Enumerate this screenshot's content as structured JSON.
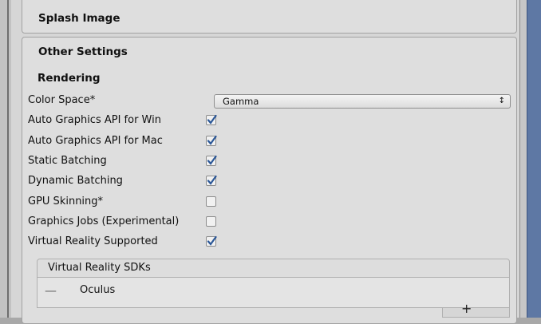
{
  "sections": {
    "splash_image": "Splash Image",
    "other_settings": "Other Settings"
  },
  "rendering": {
    "heading": "Rendering",
    "rows": [
      {
        "label": "Color Space*",
        "type": "dropdown",
        "value": "Gamma"
      },
      {
        "label": "Auto Graphics API for Win",
        "type": "checkbox",
        "checked": true
      },
      {
        "label": "Auto Graphics API for Mac",
        "type": "checkbox",
        "checked": true
      },
      {
        "label": "Static Batching",
        "type": "checkbox",
        "checked": true
      },
      {
        "label": "Dynamic Batching",
        "type": "checkbox",
        "checked": true
      },
      {
        "label": "GPU Skinning*",
        "type": "checkbox",
        "checked": false
      },
      {
        "label": "Graphics Jobs (Experimental)",
        "type": "checkbox",
        "checked": false
      },
      {
        "label": "Virtual Reality Supported",
        "type": "checkbox",
        "checked": true
      }
    ]
  },
  "vr_sdks": {
    "header": "Virtual Reality SDKs",
    "items": [
      "Oculus"
    ],
    "add_symbol": "+"
  },
  "icons": {
    "checkmark": "checkmark-icon",
    "dropdown_arrow": "updown-arrow-icon",
    "drag_handle": "drag-handle-icon"
  },
  "colors": {
    "checkmark": "#2b5797",
    "panel_bg": "#d6d6d6",
    "scrollbar": "#5e78a4"
  }
}
